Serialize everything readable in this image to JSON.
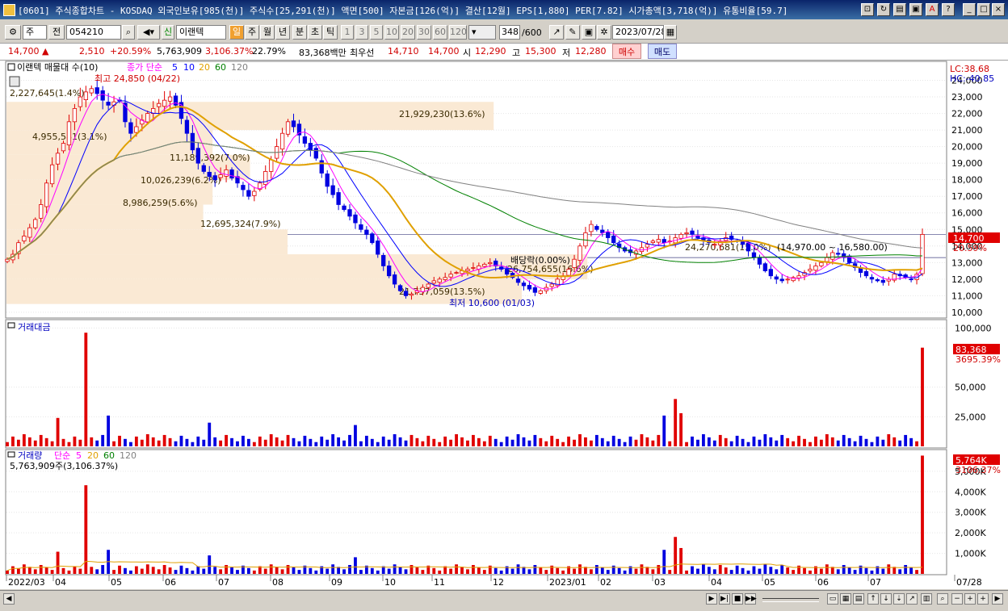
{
  "window": {
    "title": "[0601] 주식종합차트 - KOSDAQ 외국인보유[985(천)] 주식수[25,291(천)] 액면[500] 자본금[126(억)] 결산[12월] EPS[1,880] PER[7.82] 시가총액[3,718(억)] 유통비율[59.7]",
    "controls": [
      "min",
      "max",
      "close"
    ]
  },
  "toolbar": {
    "period_type": "주",
    "all_label": "전",
    "code": "054210",
    "new_label": "신",
    "stock_name": "이랜텍",
    "periods": [
      "일",
      "주",
      "월",
      "년",
      "분",
      "초",
      "틱"
    ],
    "active_period": "일",
    "intervals": [
      "1",
      "3",
      "5",
      "10",
      "20",
      "30",
      "60",
      "120"
    ],
    "count": "348",
    "count_total": "/600",
    "date": "2023/07/28"
  },
  "quote": {
    "price": "14,700",
    "arrow": "▲",
    "change": "2,510",
    "change_pct": "+20.59%",
    "volume": "5,763,909",
    "volume_pct": "3,106.37%",
    "turnover": "22.79%",
    "amount": "83,368백만",
    "best_ask_label": "최우선",
    "best_ask": "14,710",
    "best_bid": "14,700",
    "open_label": "시",
    "open": "12,290",
    "high_label": "고",
    "high": "15,300",
    "low_label": "저",
    "low": "12,280",
    "buy_label": "매수",
    "sell_label": "매도"
  },
  "panes": {
    "price": {
      "legend_name": "이랜텍 매물대 수(10)",
      "legend_ma": "종가 단순",
      "ma_periods": [
        "5",
        "10",
        "20",
        "60",
        "120"
      ],
      "ma_colors": [
        "#ff00ff",
        "#0000ff",
        "#e0a000",
        "#008000",
        "#808080"
      ],
      "lc": "LC:38.68",
      "hc": "HC:-40.85",
      "current_price_label": "14,700",
      "current_pct_label": "20.59%",
      "high_marker": "최고 24,850 (04/22)",
      "low_marker": "최저 10,600 (01/03)",
      "dividend_marker": "배당락(0.00%)",
      "range_label": "(14,970.00 ~ 16,580.00)"
    },
    "amount": {
      "legend": "거래대금",
      "last_label": "83,368",
      "last_pct": "3695.39%"
    },
    "volume": {
      "legend": "거래량",
      "legend_ma": "단순",
      "ma_periods": [
        "5",
        "20",
        "60",
        "120"
      ],
      "ma_colors": [
        "#ff00ff",
        "#e0a000",
        "#008000",
        "#808080"
      ],
      "value_label": "5,763,909주(3,106.37%)",
      "last_label": "5,764K",
      "last_pct": "3106.37%"
    }
  },
  "x_axis": [
    "2022/03",
    "04",
    "05",
    "06",
    "07",
    "08",
    "09",
    "10",
    "11",
    "12",
    "2023/01",
    "02",
    "03",
    "04",
    "05",
    "06",
    "07",
    "07/28"
  ],
  "chart_data": [
    {
      "type": "candlestick",
      "title": "",
      "y_ticks": [
        10000,
        11000,
        12000,
        13000,
        14000,
        15000,
        16000,
        17000,
        18000,
        19000,
        20000,
        21000,
        22000,
        23000,
        24000
      ],
      "ylim": [
        9800,
        25000
      ],
      "close": [
        13200,
        13500,
        14200,
        14600,
        15100,
        15600,
        16500,
        17800,
        18900,
        19600,
        20200,
        21500,
        22300,
        23000,
        23300,
        23500,
        23200,
        22800,
        22500,
        22700,
        22800,
        21500,
        20800,
        21200,
        21600,
        22000,
        22300,
        22600,
        22800,
        23000,
        22500,
        21700,
        20800,
        19800,
        19000,
        18500,
        18200,
        18000,
        18300,
        18600,
        18100,
        17800,
        17400,
        17000,
        17300,
        17800,
        18500,
        19200,
        20000,
        20800,
        21500,
        21200,
        20700,
        20200,
        19800,
        19300,
        18400,
        17600,
        17100,
        16500,
        16200,
        15800,
        15400,
        15000,
        14700,
        14200,
        13500,
        12800,
        12200,
        11700,
        11300,
        11000,
        11100,
        11300,
        11500,
        11700,
        11900,
        12000,
        12100,
        12300,
        12400,
        12500,
        12600,
        12700,
        12800,
        12900,
        13000,
        12800,
        12600,
        12300,
        12100,
        11800,
        11600,
        11400,
        11200,
        11300,
        11500,
        11700,
        12000,
        12200,
        12600,
        13200,
        14000,
        14800,
        15300,
        15000,
        14800,
        14500,
        14200,
        13900,
        13700,
        13600,
        13700,
        13900,
        14100,
        14300,
        14400,
        14200,
        14300,
        14500,
        14700,
        14800,
        14700,
        14500,
        14300,
        14200,
        14100,
        14300,
        14500,
        14400,
        14300,
        14100,
        13700,
        13300,
        12900,
        12500,
        12200,
        12000,
        11900,
        12000,
        12100,
        12200,
        12400,
        12600,
        12800,
        13000,
        13300,
        13600,
        13500,
        13300,
        13000,
        12700,
        12400,
        12200,
        12000,
        11900,
        11800,
        12000,
        12300,
        12200,
        12100,
        12000,
        12300,
        14700
      ],
      "ma_periods": [
        5,
        10,
        20,
        60,
        120
      ],
      "volume_profile_labels": [
        "2,227,645(1.4%)",
        "21,929,230(13.6%)",
        "4,955,581(3.1%)",
        "11,189,392(7.0%)",
        "10,026,239(6.2%)",
        "8,986,259(5.6%)",
        "12,695,324(7.9%)",
        "26,754,655(16.6%)",
        "24,270,681(15.0%)",
        "21,737,059(13.5%)"
      ]
    },
    {
      "type": "bar",
      "title": "",
      "y_ticks": [
        25000,
        50000,
        100000
      ],
      "ylim": [
        0,
        105000
      ],
      "last_value": 83368
    },
    {
      "type": "bar",
      "title": "",
      "y_ticks": [
        1000000,
        2000000,
        3000000,
        4000000,
        5000000
      ],
      "y_tick_labels": [
        "1,000K",
        "2,000K",
        "3,000K",
        "4,000K",
        "5,000K"
      ],
      "ylim": [
        0,
        5900000
      ],
      "last_value": 5763909
    }
  ]
}
